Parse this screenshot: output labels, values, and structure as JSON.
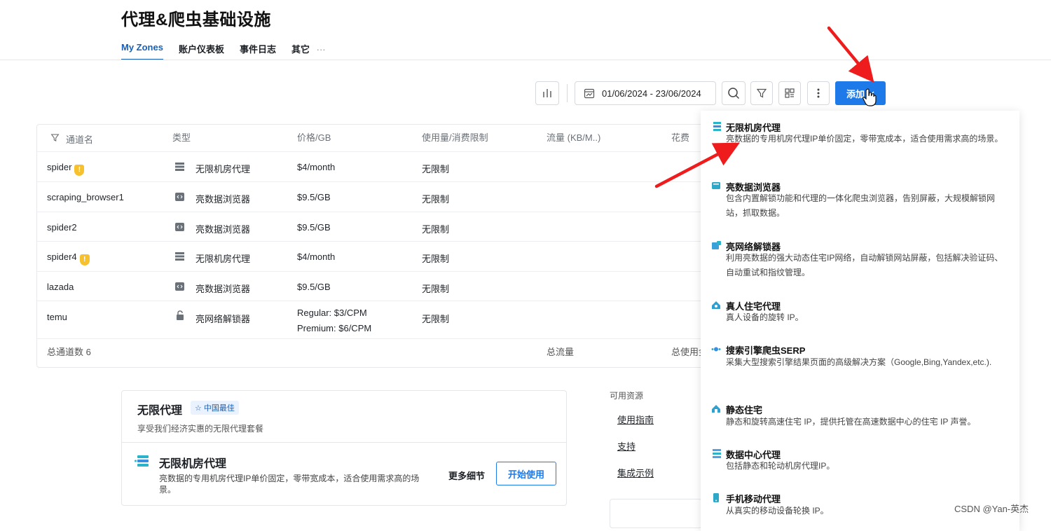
{
  "page": {
    "title": "代理&爬虫基础设施"
  },
  "tabs": [
    {
      "label": "My Zones",
      "active": true
    },
    {
      "label": "账户仪表板"
    },
    {
      "label": "事件日志"
    },
    {
      "label": "其它"
    }
  ],
  "tabs_more": "···",
  "toolbar": {
    "date_range": "01/06/2024 - 23/06/2024",
    "add_label": "添加"
  },
  "table": {
    "headers": [
      "通道名",
      "类型",
      "价格/GB",
      "使用量/消费限制",
      "流量 (KB/M..)",
      "花费"
    ],
    "rows": [
      {
        "name": "spider",
        "warning": true,
        "type": "无限机房代理",
        "type_icon": "server-stack-icon",
        "price": "$4/month",
        "limit": "无限制"
      },
      {
        "name": "scraping_browser1",
        "warning": false,
        "type": "亮数据浏览器",
        "type_icon": "code-window-icon",
        "price": "$9.5/GB",
        "limit": "无限制"
      },
      {
        "name": "spider2",
        "warning": false,
        "type": "亮数据浏览器",
        "type_icon": "code-window-icon",
        "price": "$9.5/GB",
        "limit": "无限制"
      },
      {
        "name": "spider4",
        "warning": true,
        "type": "无限机房代理",
        "type_icon": "server-stack-icon",
        "price": "$4/month",
        "limit": "无限制"
      },
      {
        "name": "lazada",
        "warning": false,
        "type": "亮数据浏览器",
        "type_icon": "code-window-icon",
        "price": "$9.5/GB",
        "limit": "无限制"
      },
      {
        "name": "temu",
        "warning": false,
        "type": "亮网络解锁器",
        "type_icon": "unlock-icon",
        "price": "Regular: $3/CPM",
        "price2": "Premium: $6/CPM",
        "limit": "无限制"
      }
    ],
    "footer": {
      "count": "总通道数 6",
      "traffic": "总流量",
      "spend": "总使用金"
    }
  },
  "promo": {
    "title": "无限代理",
    "badge": "中国最佳",
    "subtitle": "享受我们经济实惠的无限代理套餐",
    "item_title": "无限机房代理",
    "item_desc": "亮数据的专用机房代理IP单价固定，零带宽成本，适合使用需求高的场景。",
    "more_details": "更多细节",
    "start": "开始使用"
  },
  "resources": {
    "title": "可用资源",
    "links": [
      "使用指南",
      "支持",
      "集成示例"
    ]
  },
  "dropdown": {
    "items": [
      {
        "title": "无限机房代理",
        "desc": "亮数据的专用机房代理IP单价固定，零带宽成本，适合使用需求高的场景。",
        "icon": "server-stack-icon",
        "color": "#4da3e8"
      },
      {
        "title": "亮数据浏览器",
        "desc": "包含内置解锁功能和代理的一体化爬虫浏览器，告别屏蔽，大规模解锁网站，抓取数据。",
        "icon": "browser-icon",
        "color": "#2ea8c8"
      },
      {
        "title": "亮网络解锁器",
        "desc": "利用亮数据的强大动态住宅IP网络，自动解锁网站屏蔽，包括解决验证码、自动重试和指纹管理。",
        "icon": "unlock-icon",
        "color": "#3aa0d8"
      },
      {
        "title": "真人住宅代理",
        "desc": "真人设备的旋转 IP。",
        "icon": "house-icon",
        "color": "#2f9fd0"
      },
      {
        "title": "搜索引擎爬虫SERP",
        "desc": "采集大型搜索引擎结果页面的高级解决方案（Google,Bing,Yandex,etc.).",
        "icon": "search-dots-icon",
        "color": "#2bb0c8"
      },
      {
        "title": "静态住宅",
        "desc": "静态和旋转高速住宅 IP，提供托管在高速数据中心的住宅 IP 声誉。",
        "icon": "static-house-icon",
        "color": "#2fa0d0"
      },
      {
        "title": "数据中心代理",
        "desc": "包括静态和轮动机房代理IP。",
        "icon": "datacenter-icon",
        "color": "#4da3e8"
      },
      {
        "title": "手机移动代理",
        "desc": "从真实的移动设备轮换 IP。",
        "icon": "mobile-icon",
        "color": "#2ea8c8"
      }
    ]
  },
  "watermark": "CSDN @Yan-英杰",
  "colors": {
    "accent": "#1e7ae8",
    "arrow": "#ee1c1c",
    "warning": "#f7c12e"
  }
}
